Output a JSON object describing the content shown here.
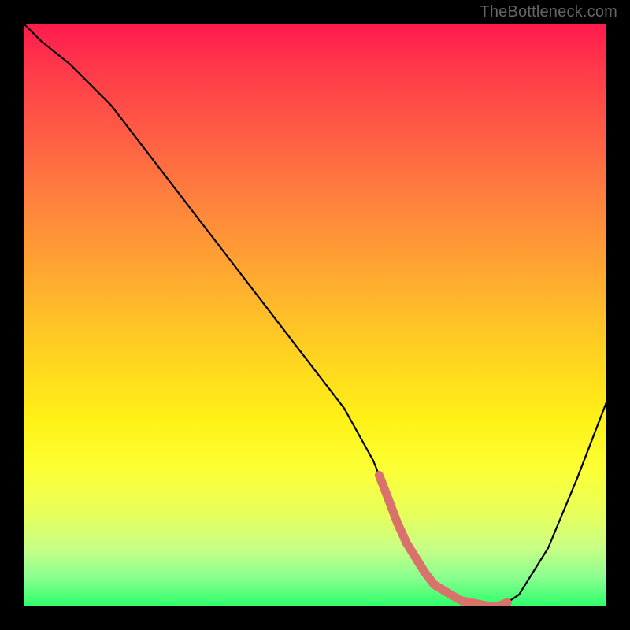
{
  "watermark": "TheBottleneck.com",
  "chart_data": {
    "type": "line",
    "title": "",
    "xlabel": "",
    "ylabel": "",
    "xlim": [
      0,
      100
    ],
    "ylim": [
      0,
      100
    ],
    "x": [
      0,
      3,
      8,
      15,
      25,
      35,
      45,
      55,
      60,
      62,
      65,
      70,
      75,
      80,
      82,
      85,
      90,
      95,
      100
    ],
    "y": [
      100,
      97,
      93,
      86,
      73,
      60,
      47,
      34,
      25,
      20,
      12,
      4,
      1,
      0,
      0,
      2,
      10,
      22,
      35
    ],
    "highlight_region_x": [
      61,
      83
    ],
    "highlight_region_note": "optimal range marker near curve minimum",
    "colors": {
      "curve": "#000000",
      "highlight": "#d8726a",
      "gradient_top": "#ff1a4d",
      "gradient_mid": "#ffd61f",
      "gradient_bottom": "#2dff6a"
    }
  }
}
